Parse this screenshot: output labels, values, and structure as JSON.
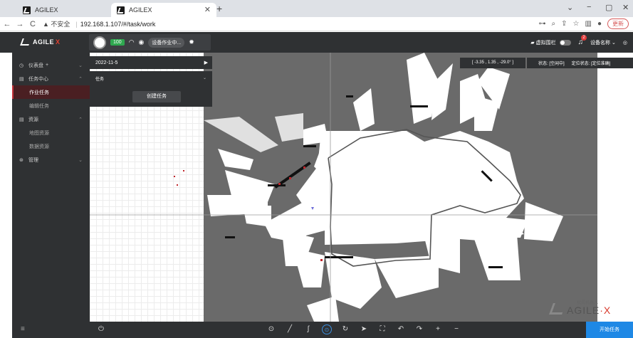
{
  "browser": {
    "tabs": [
      {
        "title": "AGILEX",
        "active": false
      },
      {
        "title": "AGILEX",
        "active": true
      }
    ],
    "new_tab": "+",
    "window_controls": [
      "⌄",
      "−",
      "▢",
      "✕"
    ],
    "nav": {
      "back": "←",
      "forward": "→",
      "reload": "C"
    },
    "address": {
      "security": "▲ 不安全",
      "url": "192.168.1.107/#/task/work"
    },
    "right_icons": [
      "⊶",
      "⌕",
      "⇪",
      "☆",
      "▥",
      "●"
    ],
    "update_label": "更新"
  },
  "app": {
    "logo": "AGILE",
    "logo_x": "X",
    "battery": "100",
    "device_status": "设备作业中...",
    "virtual_wall_label": "虚拟围栏",
    "notification_count": "2",
    "device_name": "设备名称",
    "device_chevron": "⌄"
  },
  "sidebar": {
    "items": [
      {
        "label": "仪表盘",
        "icon": "◷",
        "extra": "+",
        "chev": "⌄",
        "kind": "top"
      },
      {
        "label": "任务中心",
        "icon": "▤",
        "chev": "⌃",
        "kind": "top"
      },
      {
        "label": "作业任务",
        "kind": "sub",
        "active": true
      },
      {
        "label": "编辑任务",
        "kind": "sub"
      },
      {
        "label": "资源",
        "icon": "▤",
        "chev": "⌃",
        "kind": "top"
      },
      {
        "label": "地图资源",
        "kind": "sub"
      },
      {
        "label": "数据资源",
        "kind": "sub"
      },
      {
        "label": "管理",
        "icon": "⊛",
        "chev": "⌄",
        "kind": "top"
      }
    ],
    "menu_toggle": "≡"
  },
  "task_panel": {
    "date": "2022-11-5",
    "section_label": "任务",
    "create_button": "创建任务"
  },
  "map_info": {
    "coordinates": "[ -3.35 ,  1.35 ,  -29.0° ]",
    "state": "状态: [空闲中]",
    "locate_state": "定位状态: [定位准确]"
  },
  "watermark": {
    "sub": "松灵机器人",
    "main": "AGILE",
    "x": "·X"
  },
  "bottom_toolbar": {
    "power": "⏻",
    "tools": [
      "⊙",
      "╱",
      "ʃ",
      "⊙",
      "↻",
      "➤",
      "⛶",
      "↶",
      "↷",
      "+",
      "−"
    ],
    "active_tool_index": 3,
    "start_button": "开始任务"
  },
  "colors": {
    "accent": "#1e88e5",
    "danger": "#c4323a",
    "panel": "#2f3133"
  }
}
